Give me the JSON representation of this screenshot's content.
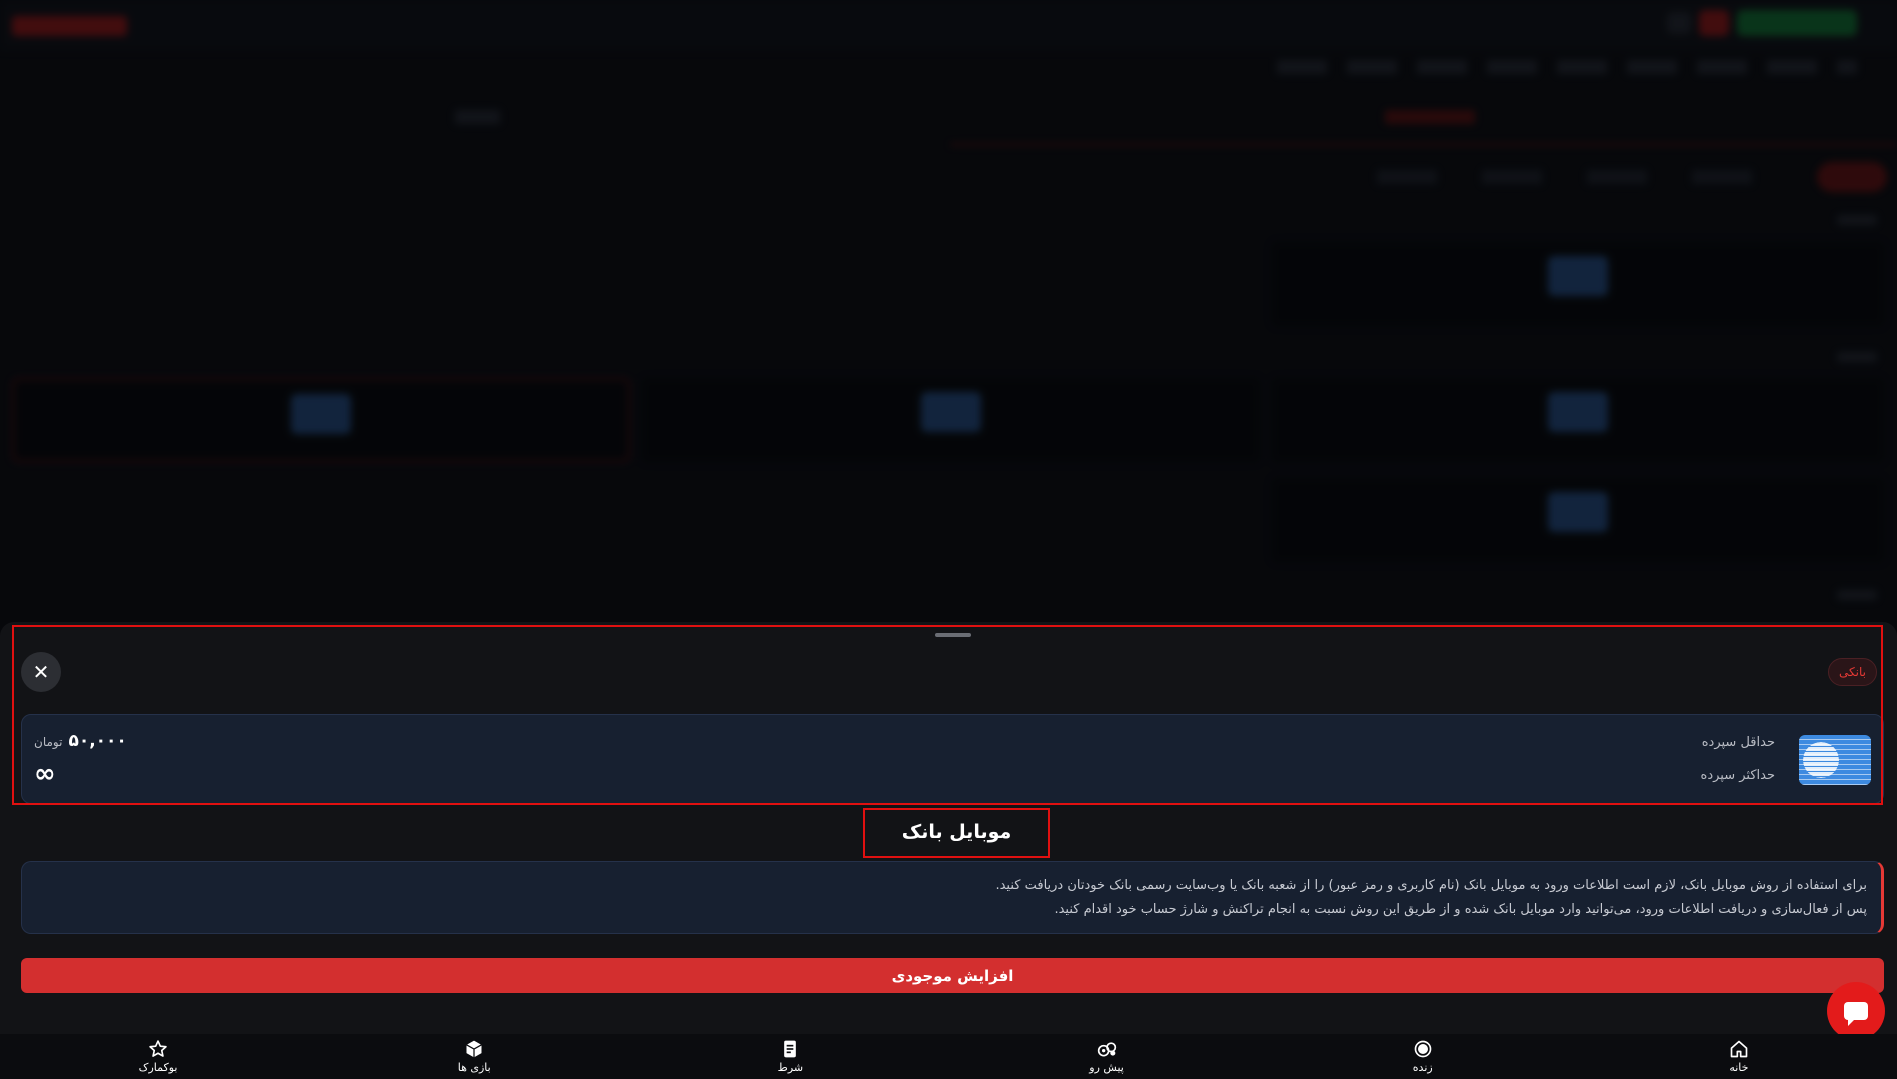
{
  "sheet": {
    "tag": "بانکی",
    "close_glyph": "✕",
    "min_deposit_label": "حداقل سپرده",
    "max_deposit_label": "حداکثر سپرده",
    "min_deposit_amount": "۵۰,۰۰۰",
    "currency": "تومان",
    "max_deposit_value": "∞",
    "method_title": "موبایل بانک",
    "description_line1": "برای استفاده از روش موبایل بانک، لازم است اطلاعات ورود به موبایل بانک (نام کاربری و رمز عبور) را از شعبه بانک یا وب‌سایت رسمی بانک خودتان دریافت کنید.",
    "description_line2": "پس از فعال‌سازی و دریافت اطلاعات ورود، می‌توانید وارد موبایل بانک شده و از طریق این روش نسبت به انجام تراکنش و شارژ حساب خود اقدام کنید.",
    "submit_label": "افزایش موجودی"
  },
  "bottom_nav": {
    "home": "خانه",
    "live": "زنده",
    "prematch": "پیش رو",
    "bet": "شرط",
    "games": "بازی ها",
    "bookmark": "بوکمارک"
  },
  "colors": {
    "accent": "#d32f2f",
    "sheet_bg": "#121316",
    "card_bg": "#172030"
  }
}
